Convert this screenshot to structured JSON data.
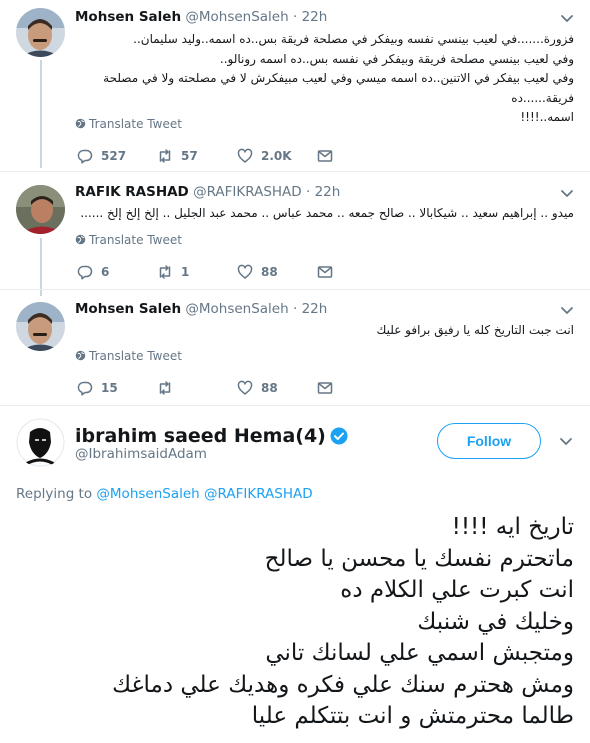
{
  "tweets": [
    {
      "name": "Mohsen Saleh",
      "handle": "@MohsenSaleh",
      "dot": "·",
      "time": "22h",
      "lines": [
        "فزورة.......في لعيب بينسي نفسه وبيفكر في مصلحة فريقة بس..ده اسمه..وليد سليمان..",
        "وفي لعيب بينسي مصلحة فريقة وبيفكر في نفسه بس..ده اسمه رونالو..",
        "وفي لعيب بيفكر في الاتنين..ده اسمه ميسي    وفي لعيب مبيفكرش لا في مصلحته ولا في مصلحة فريقة......ده",
        "اسمه..!!!!"
      ],
      "translate": "Translate Tweet",
      "reply_count": "527",
      "retweet_count": "57",
      "like_count": "2.0K"
    },
    {
      "name": "RAFIK RASHAD",
      "handle": "@RAFIKRASHAD",
      "dot": "·",
      "time": "22h",
      "lines": [
        "ميدو .. إبراهيم سعيد .. شيكابالا .. صالح جمعه .. محمد عباس .. محمد عبد الجليل .. إلخ إلخ إلخ ......"
      ],
      "translate": "Translate Tweet",
      "reply_count": "6",
      "retweet_count": "1",
      "like_count": "88"
    },
    {
      "name": "Mohsen Saleh",
      "handle": "@MohsenSaleh",
      "dot": "·",
      "time": "22h",
      "lines": [
        "انت جبت التاريخ كله يا رفيق برافو عليك"
      ],
      "translate": "Translate Tweet",
      "reply_count": "15",
      "retweet_count": "",
      "like_count": "88"
    }
  ],
  "main_tweet": {
    "name": "ibrahim saeed Hema(4)",
    "handle": "@IbrahimsaidAdam",
    "follow_label": "Follow",
    "replying_prefix": "Replying to",
    "mention_1": "@MohsenSaleh",
    "mention_2": "@RAFIKRASHAD",
    "lines": [
      "تاريخ ايه !!!!",
      "ماتحترم نفسك يا محسن يا صالح",
      "انت كبرت علي الكلام ده",
      "وخليك في شنبك",
      "ومتجبش اسمي علي لسانك تاني",
      "ومش هحترم سنك علي فكره وهديك علي دماغك",
      "طالما محترمتش و انت بتتكلم عليا"
    ]
  },
  "colors": {
    "link_blue": "#1da1f2",
    "text_gray": "#657786",
    "border": "#e6ecf0"
  },
  "icons": [
    "reply-icon",
    "retweet-icon",
    "like-icon",
    "message-icon",
    "globe-icon",
    "chevron-down-icon",
    "verified-icon"
  ]
}
